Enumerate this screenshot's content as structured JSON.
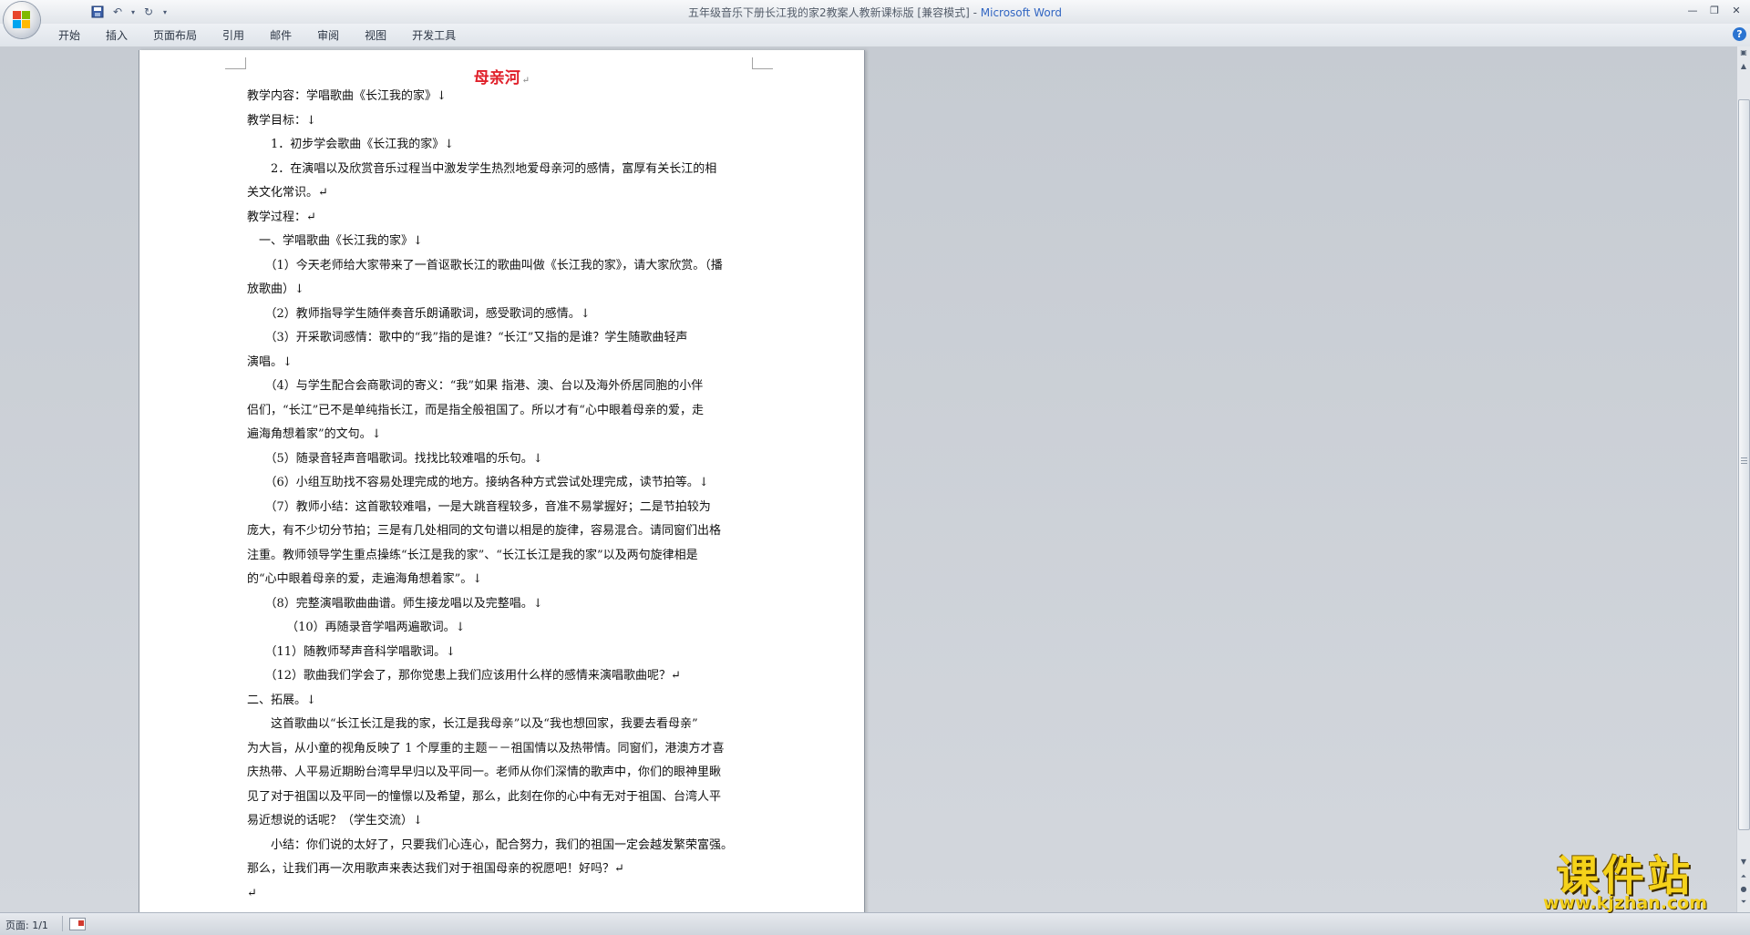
{
  "window": {
    "title_doc": "五年级音乐下册长江我的家2教案人教新课标版 [兼容模式] - ",
    "title_app": "Microsoft Word"
  },
  "qat": {
    "icons": [
      "save-icon",
      "undo-icon",
      "redo-icon",
      "customize-icon"
    ]
  },
  "ribbon": {
    "tabs": [
      "开始",
      "插入",
      "页面布局",
      "引用",
      "邮件",
      "审阅",
      "视图",
      "开发工具"
    ]
  },
  "document": {
    "title": "母亲河",
    "paragraphs": [
      "教学内容：学唱歌曲《长江我的家》↓",
      "教学目标：↓",
      "　　1．初步学会歌曲《长江我的家》↓",
      "　　2．在演唱以及欣赏音乐过程当中激发学生热烈地爱母亲河的感情，富厚有关长江的相",
      "关文化常识。↵",
      "教学过程：↵",
      "　一、学唱歌曲《长江我的家》↓",
      "　　（1）今天老师给大家带来了一首讴歌长江的歌曲叫做《长江我的家》，请大家欣赏。（播",
      "放歌曲）↓",
      "　　（2）教师指导学生随伴奏音乐朗诵歌词，感受歌词的感情。↓",
      "　　（3）开采歌词感情：歌中的“我”指的是谁？“长江”又指的是谁？学生随歌曲轻声",
      "演唱。↓",
      "　　（4）与学生配合会商歌词的寄义：“我”如果 指港、澳、台以及海外侨居同胞的小伴",
      "侣们，“长江”已不是单纯指长江，而是指全般祖国了。所以才有“心中眼着母亲的爱，走",
      "遍海角想着家”的文句。↓",
      "　　（5）随录音轻声音唱歌词。找找比较难唱的乐句。↓",
      "　　（6）小组互助找不容易处理完成的地方。接纳各种方式尝试处理完成，读节拍等。↓",
      "　　（7）教师小结：这首歌较难唱，一是大跳音程较多，音准不易掌握好；二是节拍较为",
      "庞大，有不少切分节拍；三是有几处相同的文句谱以相是的旋律，容易混合。请同窗们出格",
      "注重。教师领导学生重点操练“长江是我的家”、“长江长江是我的家”以及两句旋律相是",
      "的“心中眼着母亲的爱，走遍海角想着家”。↓",
      "　　（8）完整演唱歌曲曲谱。师生接龙唱以及完整唱。↓",
      "　　　 （10）再随录音学唱两遍歌词。↓",
      "　　（11）随教师琴声音科学唱歌词。↓",
      "　　（12）歌曲我们学会了，那你觉患上我们应该用什么样的感情来演唱歌曲呢？↵",
      "二、拓展。↓",
      "　　这首歌曲以“长江长江是我的家，长江是我母亲”以及“我也想回家，我要去看母亲”",
      "为大旨，从小童的视角反映了 1 个厚重的主题－－祖国情以及热带情。同窗们，港澳方才喜",
      "庆热带、人平易近期盼台湾早早归以及平同一。老师从你们深情的歌声中，你们的眼神里瞅",
      "见了对于祖国以及平同一的憧憬以及希望，那么，此刻在你的心中有无对于祖国、台湾人平",
      "易近想说的话呢？（学生交流）↓",
      "　　小结：你们说的太好了，只要我们心连心，配合努力，我们的祖国一定会越发繁荣富强。",
      "那么，让我们再一次用歌声来表达我们对于祖国母亲的祝愿吧！好吗？↵",
      "↵"
    ]
  },
  "status": {
    "page_count": "页面: 1/1"
  },
  "watermark": {
    "text": "课件站",
    "url": "www.kjzhan.com"
  },
  "colors": {
    "title_red": "#e0202a",
    "word_blue": "#3266c2",
    "watermark_yellow": "#f5d21a"
  }
}
